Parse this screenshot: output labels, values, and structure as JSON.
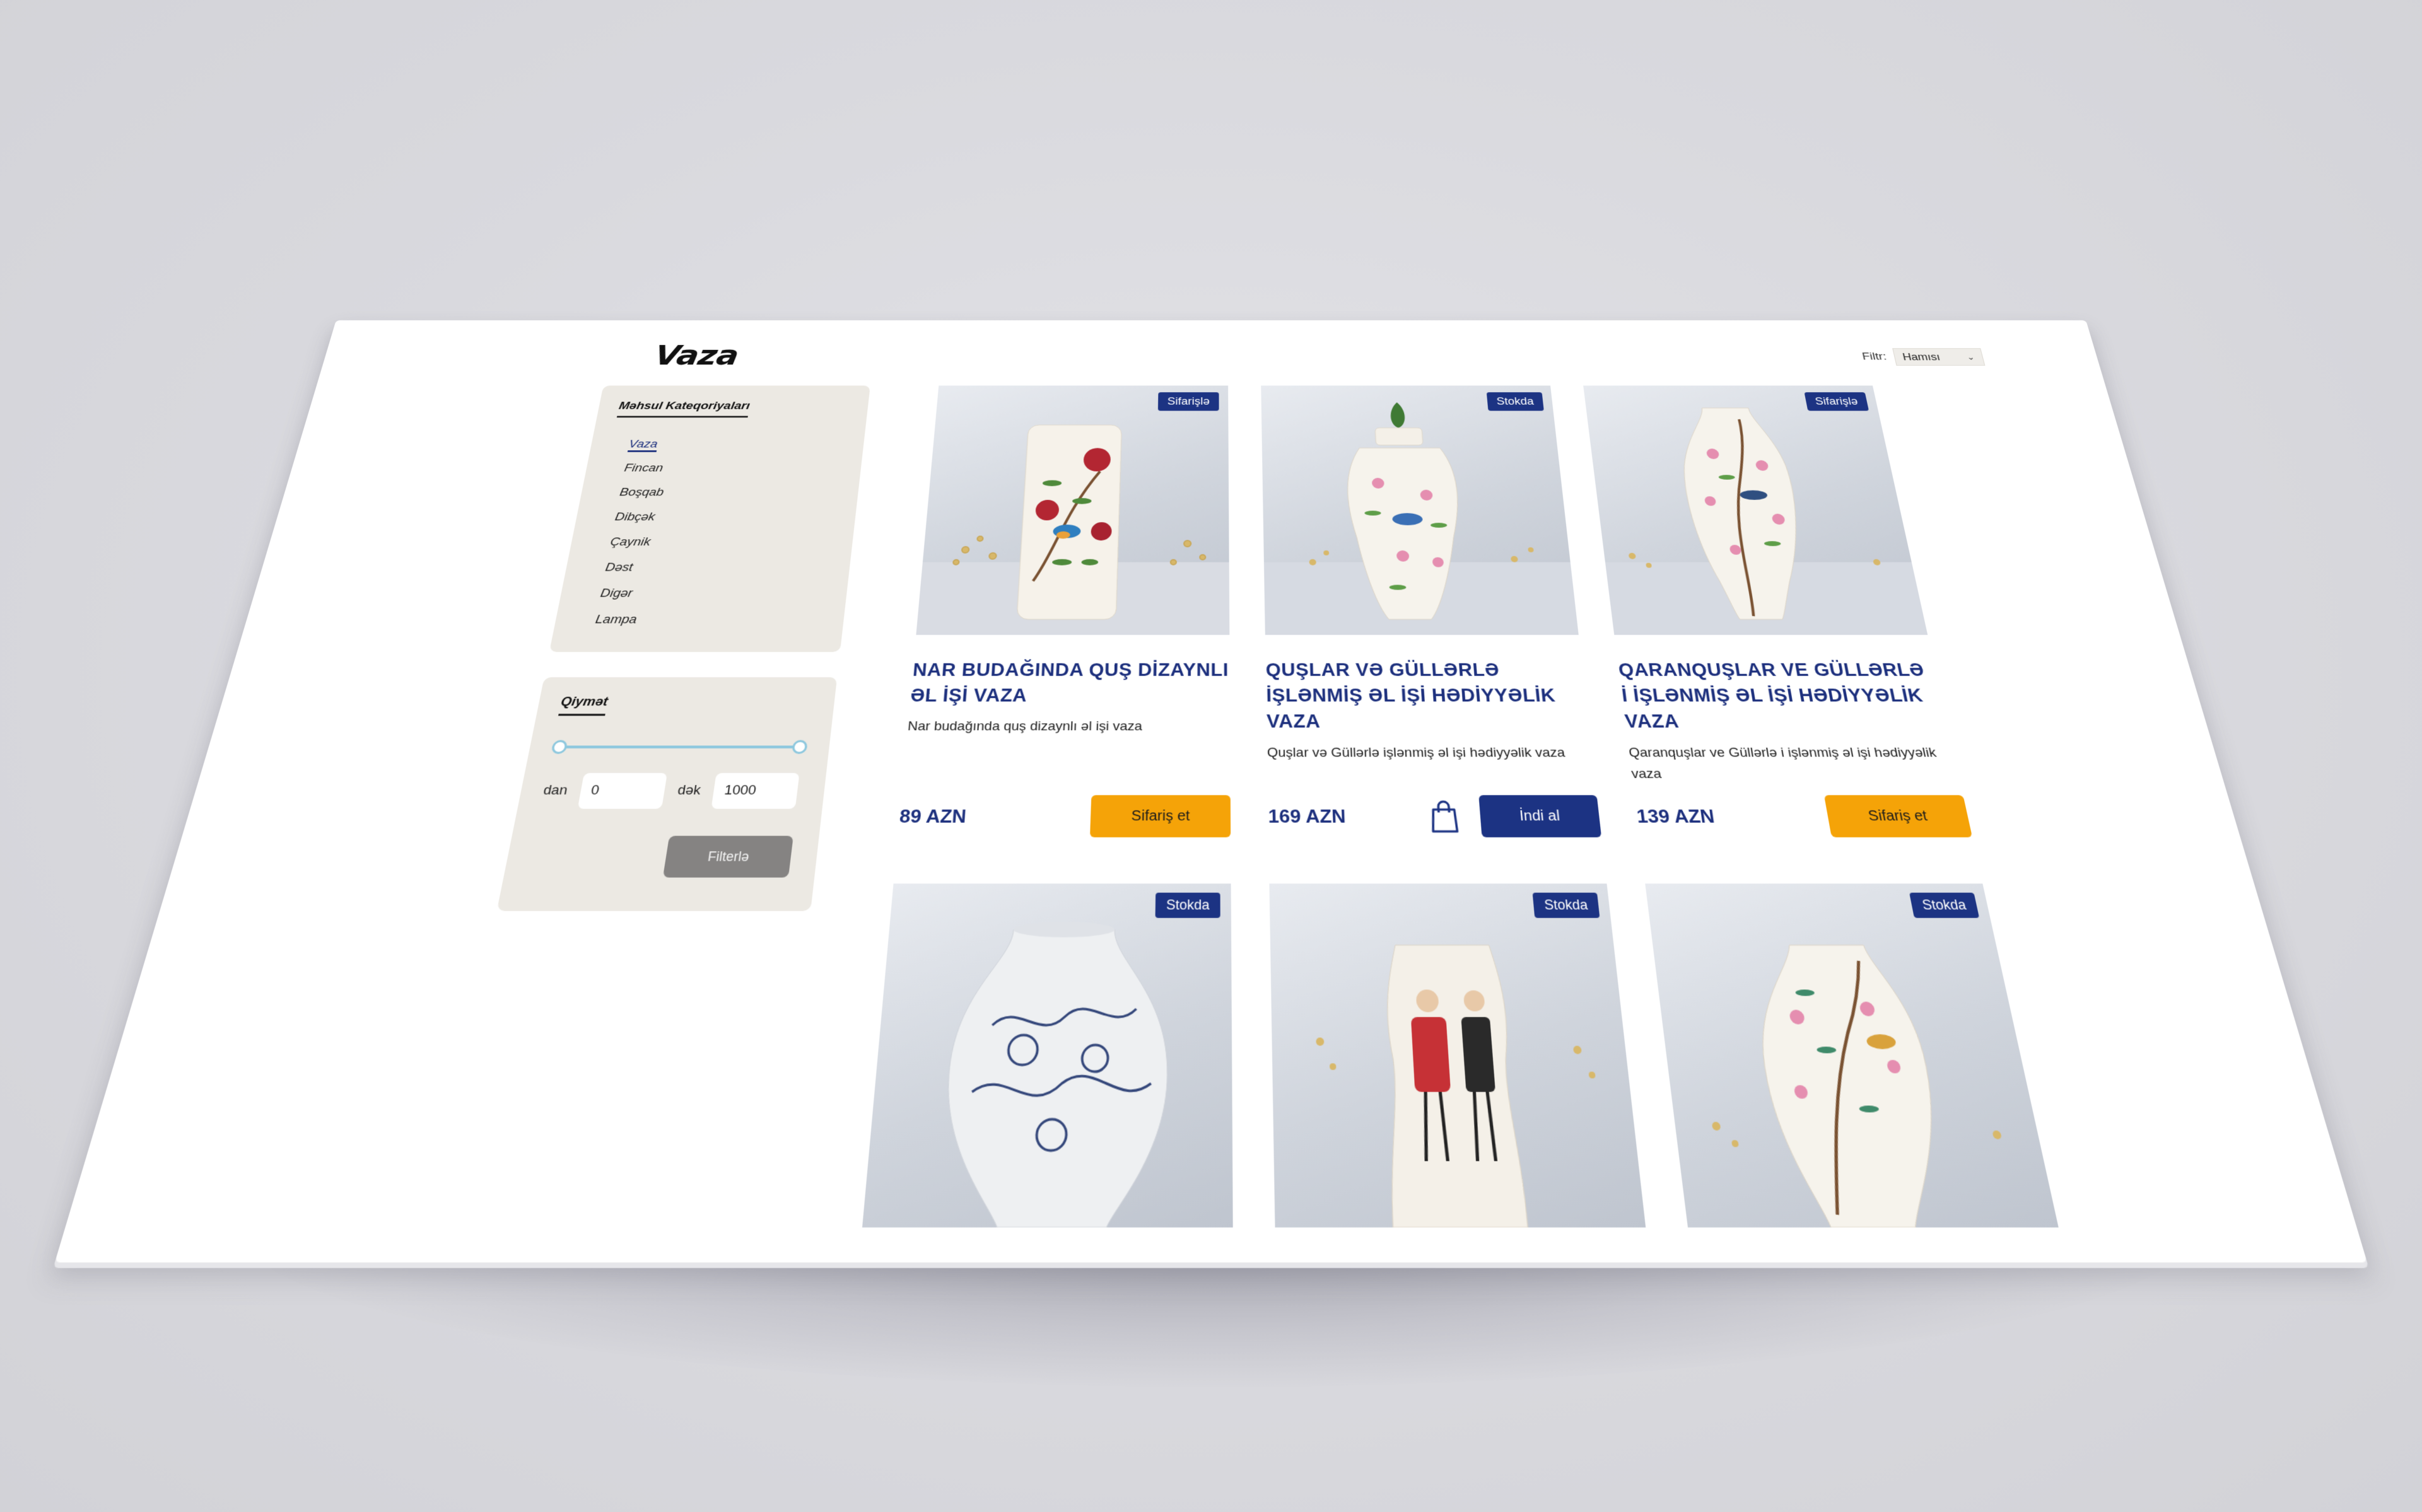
{
  "page": {
    "title": "Vaza"
  },
  "filter": {
    "label": "Filtr:",
    "selected": "Hamısı"
  },
  "categories": {
    "title": "Məhsul Kateqoriyaları",
    "items": [
      "Vaza",
      "Fincan",
      "Boşqab",
      "Dibçək",
      "Çaynik",
      "Dəst",
      "Digər",
      "Lampa"
    ],
    "active": "Vaza"
  },
  "price_filter": {
    "title": "Qiymət",
    "from_label": "dan",
    "to_label": "dək",
    "min_value": "0",
    "max_value": "1000",
    "button_label": "Filterlə"
  },
  "products": [
    {
      "badge": "Sifarişlə",
      "title": "NAR BUDAĞINDA QUŞ DİZAYNLI ƏL İŞİ VAZA",
      "description": "Nar budağında quş dizaynlı əl işi vaza",
      "price": "89 AZN",
      "button": "Sifariş et",
      "button_type": "order"
    },
    {
      "badge": "Stokda",
      "title": "QUŞLAR VƏ GÜLLƏRLƏ İŞLƏNMİŞ ƏL İŞİ HƏDİYYƏLİK VAZA",
      "description": "Quşlar və Güllərlə işlənmiş əl işi hədiyyəlik vaza",
      "price": "169 AZN",
      "button": "İndi al",
      "button_type": "buy"
    },
    {
      "badge": "Sifarişlə",
      "title": "QARANQUŞLAR VE GÜLLƏRLƏ İ İŞLƏNMİŞ ƏL İŞİ HƏDİYYƏLİK VAZA",
      "description": "Qaranquşlar ve Güllərlə i işlənmiş əl işi hədiyyəlik vaza",
      "price": "139 AZN",
      "button": "Sifariş et",
      "button_type": "order"
    },
    {
      "badge": "Stokda"
    },
    {
      "badge": "Stokda"
    },
    {
      "badge": "Stokda"
    }
  ],
  "colors": {
    "primary_blue": "#1c3383",
    "accent_orange": "#f5a308",
    "panel_bg": "#ece9e3"
  }
}
